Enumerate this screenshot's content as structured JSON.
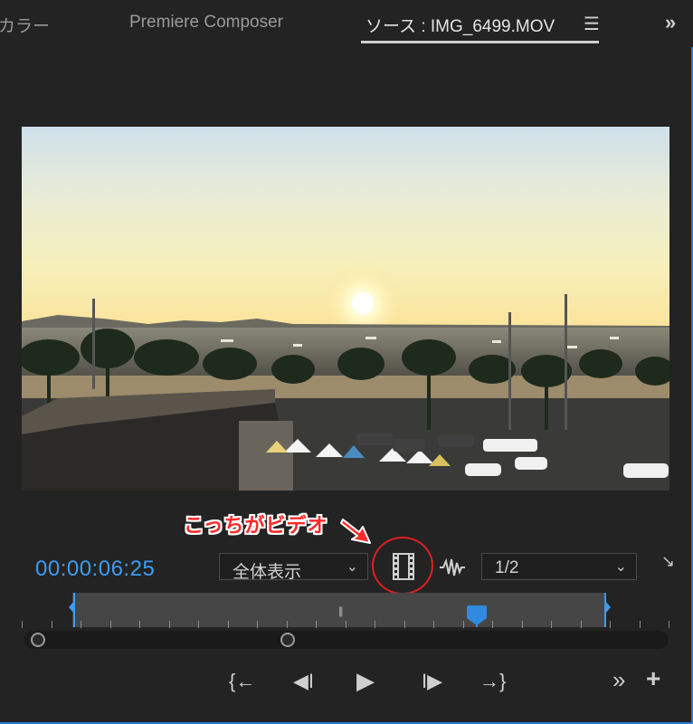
{
  "tabs": [
    {
      "label": "カラー",
      "active": false
    },
    {
      "label": "Premiere Composer",
      "active": false
    },
    {
      "label": "ソース : IMG_6499.MOV",
      "active": true
    }
  ],
  "tab_menu_icon": "hamburger-menu-icon",
  "overflow_icon": "double-chevron-right-icon",
  "annotation": {
    "text": "こっちがビデオ",
    "color": "#ff2a2a"
  },
  "controls": {
    "timecode": "00:00:06:25",
    "zoom_select": "全体表示",
    "resolution_select": "1/2",
    "drag_video_icon": "film-strip-icon",
    "drag_audio_icon": "audio-waveform-icon"
  },
  "timeline": {
    "playhead_fraction": 0.75,
    "zoom_handle_left": 0.0,
    "zoom_handle_right": 0.42
  },
  "transport": [
    {
      "name": "mark-in-button",
      "icon": "{←"
    },
    {
      "name": "step-back-button",
      "icon": "◀I"
    },
    {
      "name": "play-button",
      "icon": "▶"
    },
    {
      "name": "step-forward-button",
      "icon": "I▶"
    },
    {
      "name": "mark-out-button",
      "icon": "→}"
    },
    {
      "name": "more-buttons",
      "icon": "»"
    },
    {
      "name": "add-button",
      "icon": "+"
    }
  ],
  "colors": {
    "accent": "#3d9cf0",
    "annotation": "#e02020",
    "background": "#232323"
  }
}
